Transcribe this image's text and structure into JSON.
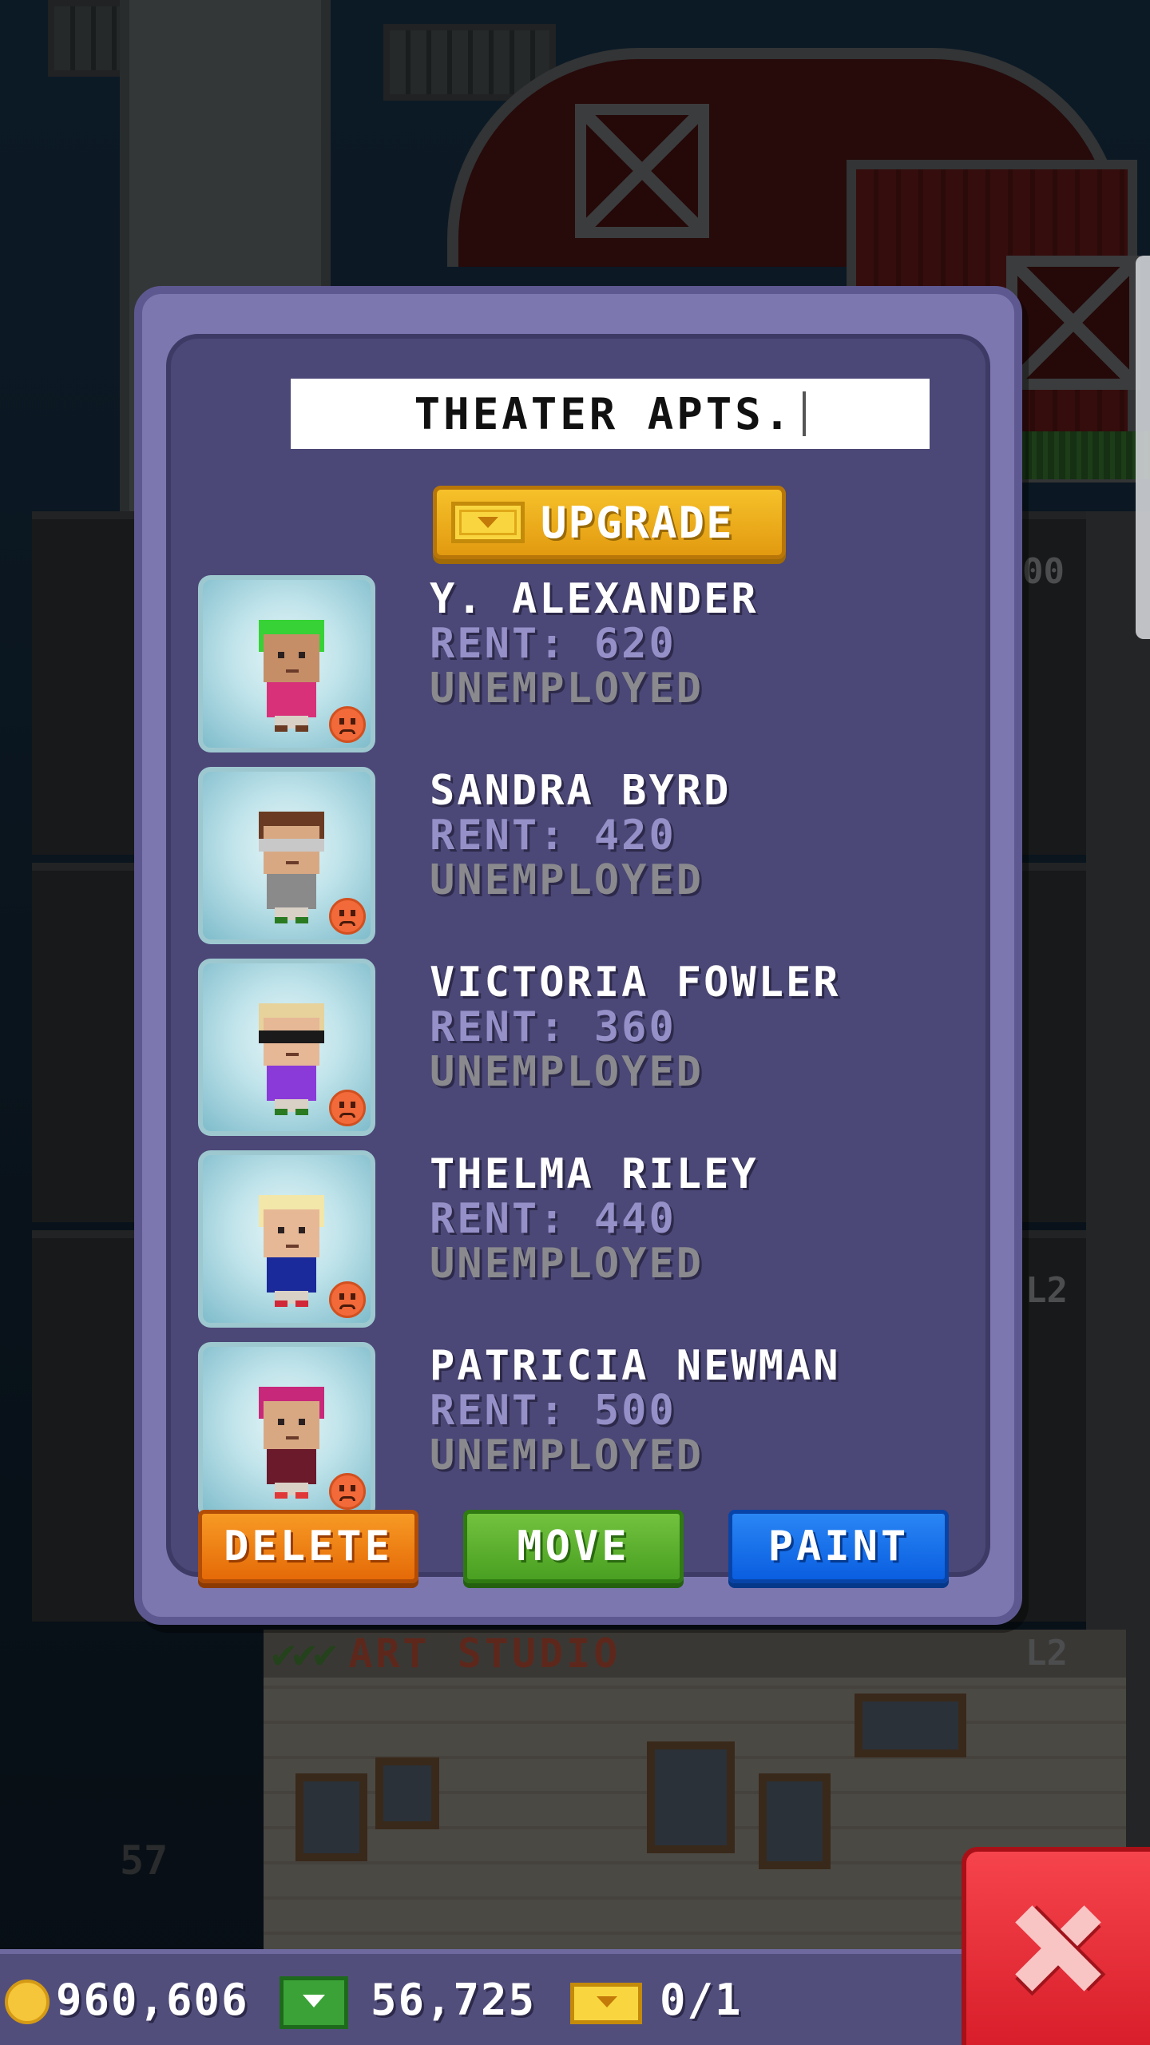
{
  "modal": {
    "title_value": "THEATER APTS.",
    "upgrade_label": "UPGRADE",
    "residents": [
      {
        "name": "Y. ALEXANDER",
        "rent": "RENT: 620",
        "job": "UNEMPLOYED",
        "avatar": {
          "hair": "#36d236",
          "skin": "#c58e67",
          "shirt": "#d8317a",
          "shoes": "#6a3b22",
          "glasses": ""
        }
      },
      {
        "name": "SANDRA BYRD",
        "rent": "RENT: 420",
        "job": "UNEMPLOYED",
        "avatar": {
          "hair": "#6a3b22",
          "skin": "#d8a883",
          "shirt": "#8a8a8a",
          "shoes": "#2a7a22",
          "glasses": "#c8c8c8"
        }
      },
      {
        "name": "VICTORIA FOWLER",
        "rent": "RENT: 360",
        "job": "UNEMPLOYED",
        "avatar": {
          "hair": "#e6d29a",
          "skin": "#e6b896",
          "shirt": "#8a3ad8",
          "shoes": "#2a7a22",
          "glasses": "#1a1a1a"
        }
      },
      {
        "name": "THELMA RILEY",
        "rent": "RENT: 440",
        "job": "UNEMPLOYED",
        "avatar": {
          "hair": "#f2e6a8",
          "skin": "#e6b896",
          "shirt": "#1a2a9a",
          "shoes": "#d02838",
          "glasses": ""
        }
      },
      {
        "name": "PATRICIA NEWMAN",
        "rent": "RENT: 500",
        "job": "UNEMPLOYED",
        "avatar": {
          "hair": "#c8287a",
          "skin": "#d8a883",
          "shirt": "#6a1a2a",
          "shoes": "#e03838",
          "glasses": ""
        }
      }
    ],
    "mood_icon": "sad-face-icon",
    "actions": {
      "delete_label": "DELETE",
      "move_label": "MOVE",
      "paint_label": "PAINT"
    },
    "colors": {
      "panel": "#7d77b0",
      "panel_inner": "#4b4776",
      "delete": "#f08014",
      "move": "#5cb22c",
      "paint": "#1a72ea",
      "close": "#e8303a"
    }
  },
  "background": {
    "floor_label": "ART STUDIO",
    "floor_level": "L2",
    "floor_level_upper": "L2",
    "floor_number": "57",
    "partial_number": "00"
  },
  "status_bar": {
    "coins": "960,606",
    "bux": "56,725",
    "tickets": "0/1",
    "coin_icon": "gold-coin-icon",
    "bux_icon": "tower-bux-icon",
    "ticket_icon": "golden-ticket-icon"
  },
  "close_icon": "close-x-icon"
}
